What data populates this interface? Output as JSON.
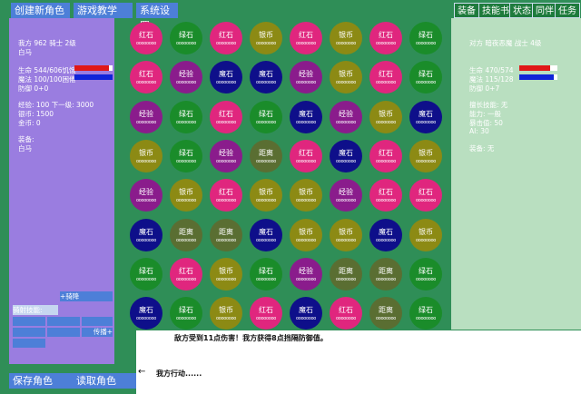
{
  "menu": {
    "create_role": "创建新角色",
    "tutorial": "游戏教学",
    "settings": "系统设置"
  },
  "right_menu": [
    "装备",
    "技能书",
    "状态",
    "同伴",
    "任务"
  ],
  "player": {
    "header": "我方  962 骑士 2级",
    "mount": "白马",
    "hp": "生命 544/606饥饿",
    "mp": "魔法 100/100困倦",
    "def": "防御 0+0",
    "exp": "经验: 100  下一级: 3000",
    "silver": "银币: 1500",
    "gold": "金币: 0",
    "equip_label": "装备:",
    "equip_value": "白马",
    "hp_fraction": 0.9,
    "mp_fraction": 1.0,
    "skill_label": "骑射技能:",
    "skill_btn_a": "+骑降",
    "skill_btn_b": "传播+"
  },
  "enemy": {
    "header": "对方   暗夜恶魔 战士 4级",
    "hp": "生命 470/574",
    "mp": "魔法 115/128",
    "def": "防御 0+7",
    "skill": "擅长技能: 无",
    "ability": "能力: 一般",
    "temper": "暴击值: 50",
    "ai": "AI: 30",
    "equip": "装备: 无",
    "hp_fraction": 0.82,
    "mp_fraction": 0.9
  },
  "board": {
    "dots": "oooooooo",
    "rows": [
      [
        "红石",
        "绿石",
        "红石",
        "银币",
        "红石",
        "银币",
        "红石",
        "绿石"
      ],
      [
        "红石",
        "经验",
        "魔石",
        "魔石",
        "经验",
        "银币",
        "红石",
        "绿石"
      ],
      [
        "经验",
        "绿石",
        "红石",
        "绿石",
        "魔石",
        "经验",
        "银币",
        "魔石"
      ],
      [
        "银币",
        "绿石",
        "经验",
        "距离",
        "红石",
        "魔石",
        "红石",
        "银币"
      ],
      [
        "经验",
        "银币",
        "红石",
        "银币",
        "银币",
        "经验",
        "红石",
        "红石"
      ],
      [
        "魔石",
        "距离",
        "距离",
        "魔石",
        "银币",
        "银币",
        "魔石",
        "银币"
      ],
      [
        "绿石",
        "红石",
        "银币",
        "绿石",
        "经验",
        "距离",
        "距离",
        "绿石"
      ],
      [
        "魔石",
        "绿石",
        "银币",
        "红石",
        "魔石",
        "红石",
        "距离",
        "绿石"
      ]
    ]
  },
  "gem_colors": {
    "红石": "#e0267e",
    "绿石": "#1a8c2a",
    "魔石": "#0e0f8a",
    "银币": "#8c8a14",
    "经验": "#8a1c8c",
    "距离": "#5a6e32"
  },
  "log": {
    "line1": "敌方受到11点伤害！我方获得8点挡隔防御值。",
    "arrow": "←",
    "line2": "我方行动......"
  },
  "bottom": {
    "save": "保存角色",
    "load": "读取角色"
  }
}
